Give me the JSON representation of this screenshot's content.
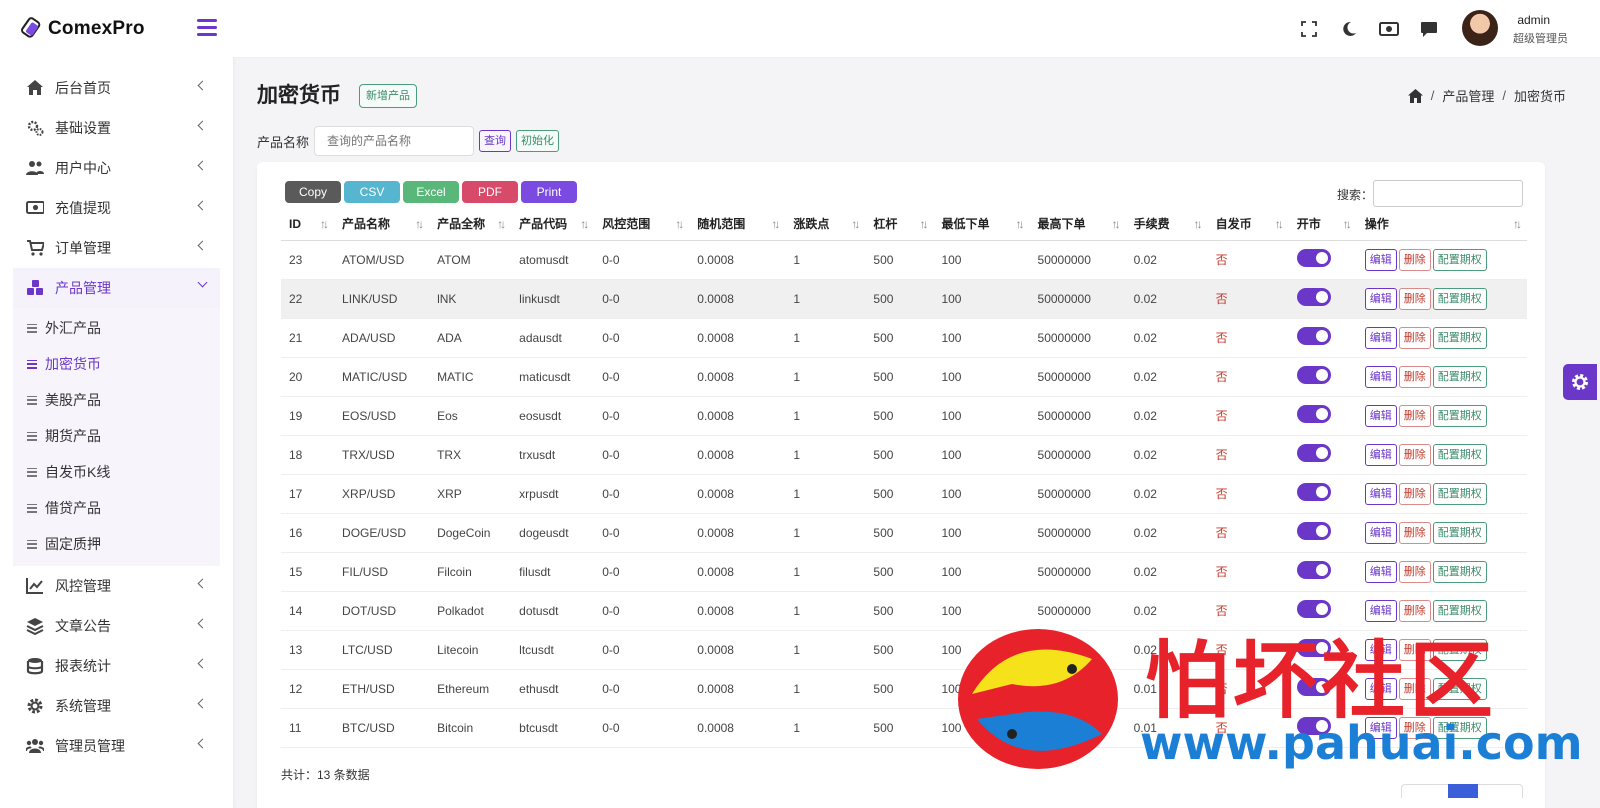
{
  "app": {
    "name": "ComexPro"
  },
  "sidebar": {
    "items": [
      {
        "label": "后台首页",
        "icon": "home-icon"
      },
      {
        "label": "基础设置",
        "icon": "cogs-icon"
      },
      {
        "label": "用户中心",
        "icon": "users-icon"
      },
      {
        "label": "充值提现",
        "icon": "money-icon"
      },
      {
        "label": "订单管理",
        "icon": "cart-icon"
      },
      {
        "label": "产品管理",
        "icon": "cubes-icon",
        "active": true
      }
    ],
    "submenu": [
      {
        "label": "外汇产品"
      },
      {
        "label": "加密货币",
        "active": true
      },
      {
        "label": "美股产品"
      },
      {
        "label": "期货产品"
      },
      {
        "label": "自发币K线"
      },
      {
        "label": "借贷产品"
      },
      {
        "label": "固定质押"
      }
    ],
    "items_after": [
      {
        "label": "风控管理",
        "icon": "chart-line-icon"
      },
      {
        "label": "文章公告",
        "icon": "layers-icon"
      },
      {
        "label": "报表统计",
        "icon": "database-icon"
      },
      {
        "label": "系统管理",
        "icon": "gear-icon"
      },
      {
        "label": "管理员管理",
        "icon": "user-group-icon"
      }
    ]
  },
  "header": {
    "user_name": "admin",
    "user_role": "超级管理员",
    "icons": [
      "fullscreen-icon",
      "moon-icon",
      "money-icon",
      "chat-icon"
    ]
  },
  "page": {
    "title": "加密货币",
    "new_button": "新增产品",
    "breadcrumb": [
      "产品管理",
      "加密货币"
    ]
  },
  "filter": {
    "label": "产品名称",
    "placeholder": "查询的产品名称",
    "query_button": "查询",
    "reset_button": "初始化"
  },
  "table_tools": {
    "exports": [
      {
        "label": "Copy",
        "color": "#5a5a5a"
      },
      {
        "label": "CSV",
        "color": "#56b6d0"
      },
      {
        "label": "Excel",
        "color": "#5ab77a"
      },
      {
        "label": "PDF",
        "color": "#d84a6a"
      },
      {
        "label": "Print",
        "color": "#7b4ae0"
      }
    ],
    "search_label": "搜索："
  },
  "table": {
    "columns": [
      "ID",
      "产品名称",
      "产品全称",
      "产品代码",
      "风控范围",
      "随机范围",
      "涨跌点",
      "杠杆",
      "最低下单",
      "最高下单",
      "手续费",
      "自发币",
      "开市",
      "操作"
    ],
    "rows": [
      [
        "23",
        "ATOM/USD",
        "ATOM",
        "atomusdt",
        "0-0",
        "0.0008",
        "1",
        "500",
        "100",
        "50000000",
        "0.02",
        "否"
      ],
      [
        "22",
        "LINK/USD",
        "lNK",
        "linkusdt",
        "0-0",
        "0.0008",
        "1",
        "500",
        "100",
        "50000000",
        "0.02",
        "否"
      ],
      [
        "21",
        "ADA/USD",
        "ADA",
        "adausdt",
        "0-0",
        "0.0008",
        "1",
        "500",
        "100",
        "50000000",
        "0.02",
        "否"
      ],
      [
        "20",
        "MATIC/USD",
        "MATIC",
        "maticusdt",
        "0-0",
        "0.0008",
        "1",
        "500",
        "100",
        "50000000",
        "0.02",
        "否"
      ],
      [
        "19",
        "EOS/USD",
        "Eos",
        "eosusdt",
        "0-0",
        "0.0008",
        "1",
        "500",
        "100",
        "50000000",
        "0.02",
        "否"
      ],
      [
        "18",
        "TRX/USD",
        "TRX",
        "trxusdt",
        "0-0",
        "0.0008",
        "1",
        "500",
        "100",
        "50000000",
        "0.02",
        "否"
      ],
      [
        "17",
        "XRP/USD",
        "XRP",
        "xrpusdt",
        "0-0",
        "0.0008",
        "1",
        "500",
        "100",
        "50000000",
        "0.02",
        "否"
      ],
      [
        "16",
        "DOGE/USD",
        "DogeCoin",
        "dogeusdt",
        "0-0",
        "0.0008",
        "1",
        "500",
        "100",
        "50000000",
        "0.02",
        "否"
      ],
      [
        "15",
        "FIL/USD",
        "Filcoin",
        "filusdt",
        "0-0",
        "0.0008",
        "1",
        "500",
        "100",
        "50000000",
        "0.02",
        "否"
      ],
      [
        "14",
        "DOT/USD",
        "Polkadot",
        "dotusdt",
        "0-0",
        "0.0008",
        "1",
        "500",
        "100",
        "50000000",
        "0.02",
        "否"
      ],
      [
        "13",
        "LTC/USD",
        "Litecoin",
        "ltcusdt",
        "0-0",
        "0.0008",
        "1",
        "500",
        "100",
        "",
        "0.02",
        "否"
      ],
      [
        "12",
        "ETH/USD",
        "Ethereum",
        "ethusdt",
        "0-0",
        "0.0008",
        "1",
        "500",
        "100",
        "",
        "0.01",
        "否"
      ],
      [
        "11",
        "BTC/USD",
        "Bitcoin",
        "btcusdt",
        "0-0",
        "0.0008",
        "1",
        "500",
        "100",
        "",
        "0.01",
        "否"
      ]
    ],
    "actions": [
      "编辑",
      "删除",
      "配置期权"
    ],
    "highlight_row": 1
  },
  "footer": {
    "total": "共计：13 条数据"
  },
  "watermark": {
    "text": "怕坏社区",
    "url": "www.pahuai.com"
  },
  "colors": {
    "accent": "#6a37c8"
  }
}
